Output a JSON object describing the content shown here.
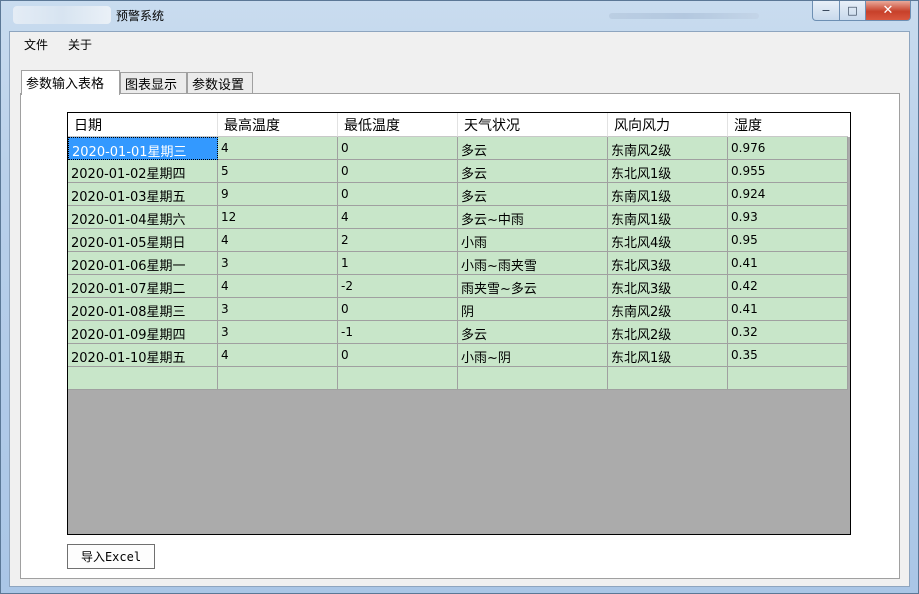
{
  "window": {
    "title": "预警系统",
    "minimize_label": "−",
    "maximize_label": "□",
    "close_label": "✕"
  },
  "menu": [
    "文件",
    "关于"
  ],
  "tabs": [
    "参数输入表格",
    "图表显示",
    "参数设置"
  ],
  "table": {
    "columns": [
      "日期",
      "最高温度",
      "最低温度",
      "天气状况",
      "风向风力",
      "湿度"
    ],
    "rows": [
      [
        "2020-01-01星期三",
        "4",
        "0",
        "多云",
        "东南风2级",
        "0.976"
      ],
      [
        "2020-01-02星期四",
        "5",
        "0",
        "多云",
        "东北风1级",
        "0.955"
      ],
      [
        "2020-01-03星期五",
        "9",
        "0",
        "多云",
        "东南风1级",
        "0.924"
      ],
      [
        "2020-01-04星期六",
        "12",
        "4",
        "多云~中雨",
        "东南风1级",
        "0.93"
      ],
      [
        "2020-01-05星期日",
        "4",
        "2",
        "小雨",
        "东北风4级",
        "0.95"
      ],
      [
        "2020-01-06星期一",
        "3",
        "1",
        "小雨~雨夹雪",
        "东北风3级",
        "0.41"
      ],
      [
        "2020-01-07星期二",
        "4",
        "-2",
        "雨夹雪~多云",
        "东北风3级",
        "0.42"
      ],
      [
        "2020-01-08星期三",
        "3",
        "0",
        "阴",
        "东南风2级",
        "0.41"
      ],
      [
        "2020-01-09星期四",
        "3",
        "-1",
        "多云",
        "东北风2级",
        "0.32"
      ],
      [
        "2020-01-10星期五",
        "4",
        "0",
        "小雨~阴",
        "东北风1级",
        "0.35"
      ]
    ]
  },
  "import_button": "导入Excel",
  "colors": {
    "row_background": "#c8e6c9",
    "selection": "#3399ff",
    "empty_area": "#ababab"
  }
}
